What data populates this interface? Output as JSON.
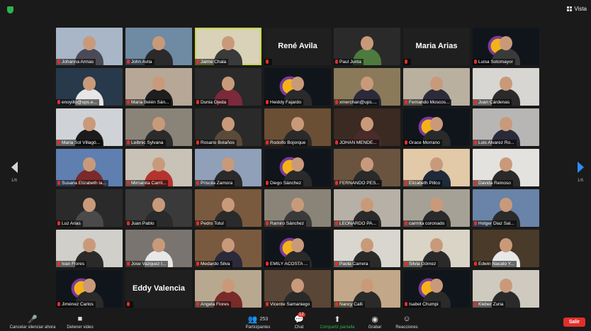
{
  "view_button": {
    "label": "Vista"
  },
  "pager": {
    "left": "1/6",
    "right": "1/6"
  },
  "colors": {
    "active_border": "#c4d84a",
    "leave": "#e0302a",
    "share": "#2fb24c",
    "accent": "#2d8cff"
  },
  "participants": [
    {
      "name": "Johanna Armas",
      "bg": "#a8b6c8",
      "shirt": "#4a4a56",
      "muted": true
    },
    {
      "name": "John Avila",
      "bg": "#6f8aa3",
      "shirt": "#2a2a2a",
      "muted": true
    },
    {
      "name": "Jaime Chala",
      "bg": "#d9d2b8",
      "shirt": "#3a3a3a",
      "muted": true,
      "active": true
    },
    {
      "name": "René Avila",
      "bg": "#1f1f1f",
      "muted": true,
      "video_off": true
    },
    {
      "name": "Paul Junta",
      "bg": "#2a2a2a",
      "shirt": "#4d7a3e",
      "muted": true
    },
    {
      "name": "Maria Arias",
      "bg": "#1f1f1f",
      "muted": true,
      "video_off": true
    },
    {
      "name": "Luisa Sotomayor",
      "bg": "#10151c",
      "shirt": "#3a3a3a",
      "muted": true,
      "emblem": true
    },
    {
      "name": "enoyillo@ups.e...",
      "bg": "#27394a",
      "shirt": "#e6e6e6",
      "muted": true
    },
    {
      "name": "Maria Belén Sán...",
      "bg": "#b7a796",
      "shirt": "#1e1e1e",
      "muted": true
    },
    {
      "name": "Dunia Ojeda",
      "bg": "#2a2a2a",
      "shirt": "#7a2a3a",
      "muted": true
    },
    {
      "name": "Heiddy Fajardo",
      "bg": "#10151c",
      "shirt": "#2a2a2a",
      "muted": true,
      "emblem": true
    },
    {
      "name": "xmerchan@ups....",
      "bg": "#8a7a5a",
      "shirt": "#2a2a3a",
      "muted": true
    },
    {
      "name": "Fernando Moscos...",
      "bg": "#b9b0a0",
      "shirt": "#2b2b3a",
      "muted": true
    },
    {
      "name": "Juan Cárdenas",
      "bg": "#d8d6d2",
      "shirt": "#2a2a2a",
      "muted": true
    },
    {
      "name": "Maria Sol Villagó...",
      "bg": "#cfd3d8",
      "shirt": "#1b1b1b",
      "muted": true
    },
    {
      "name": "Leibnic Sylvana",
      "bg": "#8a8478",
      "shirt": "#2b2b2b",
      "muted": true
    },
    {
      "name": "Rosario Bolaños",
      "bg": "#2a2a2a",
      "shirt": "#5a4a3a",
      "muted": true
    },
    {
      "name": "Rodolfo Bojorque",
      "bg": "#6a4f35",
      "shirt": "#2a2a2a",
      "muted": true
    },
    {
      "name": "JOHAN MENDE...",
      "bg": "#3a2a22",
      "shirt": "#4a2a2a",
      "muted": true
    },
    {
      "name": "Grace Morrano",
      "bg": "#10151c",
      "shirt": "#2a2a2a",
      "muted": true,
      "emblem": true
    },
    {
      "name": "Luis Alvarez Ro...",
      "bg": "#b8b6b4",
      "shirt": "#2a2a3a",
      "muted": true
    },
    {
      "name": "Susana Elizabeth la...",
      "bg": "#5f7fb0",
      "shirt": "#7a2a2a",
      "muted": true
    },
    {
      "name": "Mirnanita Carril...",
      "bg": "#c9c2b6",
      "shirt": "#b5332e",
      "muted": true
    },
    {
      "name": "Priscila Zamora",
      "bg": "#8fa0b8",
      "shirt": "#2a2a2a",
      "muted": true
    },
    {
      "name": "Diego Sánchez",
      "bg": "#10151c",
      "shirt": "#2a2a2a",
      "muted": true,
      "emblem": true
    },
    {
      "name": "FERNANDO PES...",
      "bg": "#6a5440",
      "shirt": "#2a2a2a",
      "muted": true
    },
    {
      "name": "Elizabeth Pillco",
      "bg": "#e2c9a8",
      "shirt": "#1e2a3a",
      "muted": true
    },
    {
      "name": "Davida Reinoso",
      "bg": "#e4e2de",
      "shirt": "#2a2a2a",
      "muted": true
    },
    {
      "name": "Luz Arias",
      "bg": "#2a2a2a",
      "shirt": "#4a4a4a",
      "muted": true
    },
    {
      "name": "Juan Pablo",
      "bg": "#3a3a3a",
      "shirt": "#2a2a2a",
      "muted": true
    },
    {
      "name": "Pedro Totul",
      "bg": "#7a5a3e",
      "shirt": "#2a2a2a",
      "muted": true
    },
    {
      "name": "Ramiro Sánchez",
      "bg": "#8a8478",
      "shirt": "#3a3a3a",
      "muted": true
    },
    {
      "name": "LEONARDO PA...",
      "bg": "#b7b0a6",
      "shirt": "#2a2a2a",
      "muted": true
    },
    {
      "name": "carmita coronado",
      "bg": "#a6a196",
      "shirt": "#2a2a2a",
      "muted": true
    },
    {
      "name": "Holger Diaz Sal...",
      "bg": "#6a83a8",
      "shirt": "#2a2a2a",
      "muted": true
    },
    {
      "name": "Ivan Flores",
      "bg": "#d0cfca",
      "shirt": "#2a2a2a",
      "muted": true
    },
    {
      "name": "Jose Vazquez I...",
      "bg": "#7a7470",
      "shirt": "#e8e8e8",
      "muted": true
    },
    {
      "name": "Medardo Silva",
      "bg": "#7a5a3e",
      "shirt": "#2a2a3a",
      "muted": true
    },
    {
      "name": "EMILY ACOSTA ...",
      "bg": "#10151c",
      "shirt": "#2a2a2a",
      "muted": true,
      "emblem": true
    },
    {
      "name": "Paola Carrera",
      "bg": "#d9d6cf",
      "shirt": "#2a2a2a",
      "muted": true
    },
    {
      "name": "Silvia Gómez",
      "bg": "#d9d4c6",
      "shirt": "#2a2a2a",
      "muted": true
    },
    {
      "name": "Edwin Nacato Y...",
      "bg": "#4a3a2a",
      "shirt": "#e8e8e8",
      "muted": true
    },
    {
      "name": "Jiménez Carlos",
      "bg": "#10151c",
      "shirt": "#2a2a2a",
      "muted": true,
      "emblem": true
    },
    {
      "name": "Eddy Valencia",
      "bg": "#1f1f1f",
      "muted": true,
      "video_off": true
    },
    {
      "name": "Angela Flores",
      "bg": "#b8a890",
      "shirt": "#7a2a2a",
      "muted": true
    },
    {
      "name": "Vicente Samaniego",
      "bg": "#5a4636",
      "shirt": "#2a2a2a",
      "muted": true
    },
    {
      "name": "Nancy Calli",
      "bg": "#c2a888",
      "shirt": "#2a2a2a",
      "muted": true
    },
    {
      "name": "Isabel Chumpi",
      "bg": "#10151c",
      "shirt": "#2a2a2a",
      "muted": true,
      "emblem": true
    },
    {
      "name": "Kleber Zuria",
      "bg": "#cfcac0",
      "shirt": "#2a2a2a",
      "muted": true
    }
  ],
  "toolbar": {
    "mute_label": "Cancelar silenciar ahora",
    "video_label": "Detener video",
    "participants_label": "Participantes",
    "participants_count": "253",
    "chat_label": "Chat",
    "chat_badge": "12",
    "share_label": "Compartir pantalla",
    "record_label": "Grabar",
    "reactions_label": "Reacciones",
    "leave_label": "Salir"
  }
}
